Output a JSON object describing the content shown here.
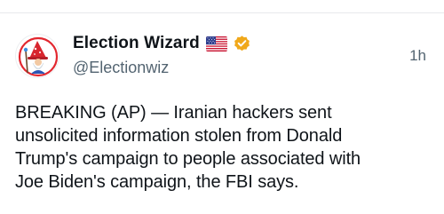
{
  "post": {
    "author": {
      "display_name": "Election Wizard",
      "handle": "@Electionwiz",
      "verified": true,
      "flag_icon": "us-flag-icon",
      "verified_icon": "verified-badge-icon",
      "avatar_icon": "wizard-avatar-icon"
    },
    "timestamp": "1h",
    "body": "BREAKING (AP) — Iranian hackers sent\nunsolicited information stolen from Donald\nTrump's campaign to people associated with\nJoe Biden's campaign, the FBI says."
  },
  "colors": {
    "verified_badge": "#f0a81a",
    "avatar_ring": "#e2272f",
    "secondary_text": "#536471",
    "primary_text": "#0f1419"
  }
}
